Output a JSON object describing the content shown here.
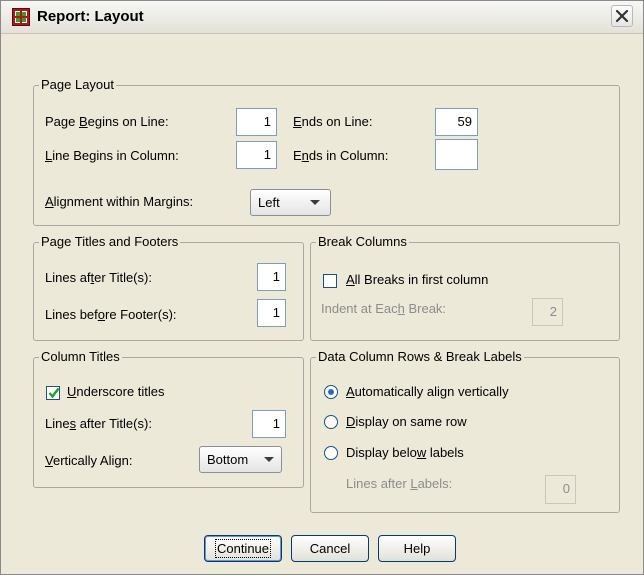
{
  "window": {
    "title": "Report: Layout",
    "app_icon": "spss-report-icon",
    "close_icon": "close-icon"
  },
  "page_layout": {
    "legend": "Page Layout",
    "begins_on_line": {
      "pre": "Page ",
      "key": "B",
      "post": "egins on Line:",
      "value": "1"
    },
    "ends_on_line": {
      "pre": "",
      "key": "E",
      "post": "nds on Line:",
      "value": "59"
    },
    "line_begins_col": {
      "pre": "",
      "key": "L",
      "post": "ine Begins in Column:",
      "value": "1"
    },
    "ends_in_col": {
      "pre": "E",
      "key": "n",
      "post": "ds in Column:",
      "value": ""
    },
    "alignment": {
      "pre": "",
      "key": "A",
      "post": "lignment within Margins:",
      "value": "Left"
    }
  },
  "titles_footers": {
    "legend": "Page Titles and Footers",
    "lines_after_title": {
      "pre": "Lines af",
      "key": "t",
      "post": "er Title(s):",
      "value": "1"
    },
    "lines_before_footer": {
      "pre": "Lines bef",
      "key": "o",
      "post": "re Footer(s):",
      "value": "1"
    }
  },
  "break_columns": {
    "legend": "Break Columns",
    "all_breaks": {
      "pre": "",
      "key": "A",
      "post": "ll Breaks in first column",
      "checked": false
    },
    "indent": {
      "pre": "Indent at Eac",
      "key": "h",
      "post": " Break:",
      "value": "2"
    }
  },
  "column_titles": {
    "legend": "Column Titles",
    "underscore": {
      "pre": "",
      "key": "U",
      "post": "nderscore titles",
      "checked": true
    },
    "lines_after_title": {
      "pre": "Line",
      "key": "s",
      "post": " after Title(s):",
      "value": "1"
    },
    "vertical_align": {
      "pre": "",
      "key": "V",
      "post": "ertically Align:",
      "value": "Bottom"
    }
  },
  "data_rows": {
    "legend": "Data Column Rows & Break Labels",
    "options": [
      {
        "pre": "",
        "key": "A",
        "post": "utomatically align vertically",
        "selected": true
      },
      {
        "pre": "",
        "key": "D",
        "post": "isplay on same row",
        "selected": false
      },
      {
        "pre": "Display belo",
        "key": "w",
        "post": " labels",
        "selected": false
      }
    ],
    "lines_after_labels": {
      "pre": "Lines after ",
      "key": "L",
      "post": "abels:",
      "value": "0"
    }
  },
  "buttons": {
    "continue": "Continue",
    "cancel": "Cancel",
    "help": "Help"
  }
}
